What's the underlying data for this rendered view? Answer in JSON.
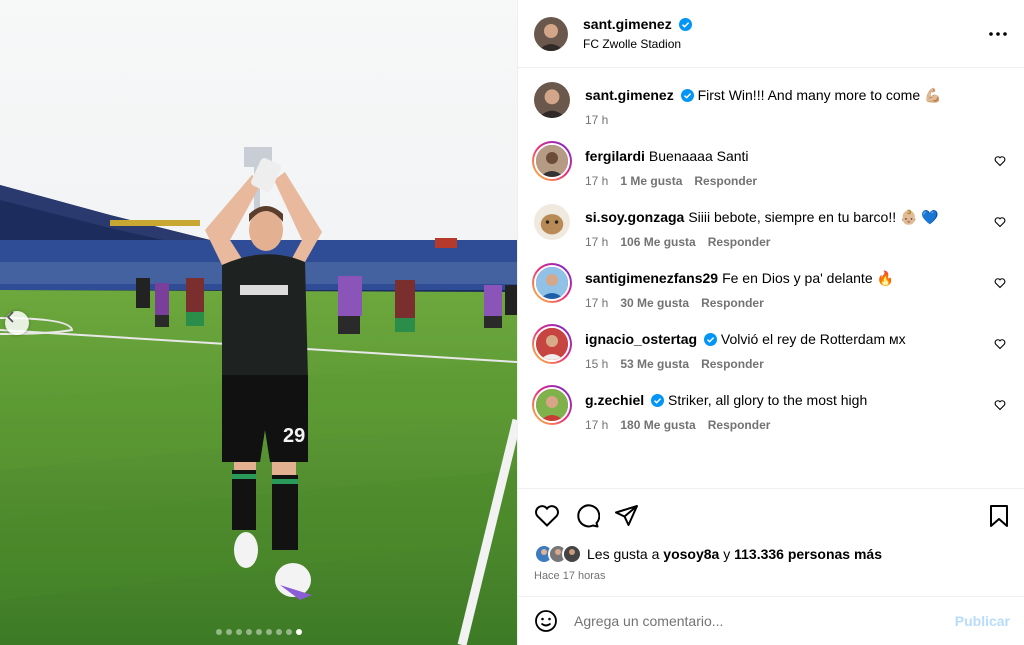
{
  "post": {
    "author": "sant.gimenez",
    "location": "FC Zwolle Stadion",
    "caption": "First Win!!! And many more to come 💪🏼",
    "caption_time": "17 h",
    "photo_count": 9,
    "active_photo": 9
  },
  "comments": [
    {
      "user": "fergilardi",
      "text": "Buenaaaa Santi",
      "time": "17 h",
      "likes": "1 Me gusta",
      "reply": "Responder",
      "verified": false
    },
    {
      "user": "si.soy.gonzaga",
      "text": "Siiii bebote, siempre en tu barco!! 👶🏼 💙",
      "time": "17 h",
      "likes": "106 Me gusta",
      "reply": "Responder",
      "verified": false
    },
    {
      "user": "santigimenezfans29",
      "text": "Fe en Dios y pa' delante 🔥",
      "time": "17 h",
      "likes": "30 Me gusta",
      "reply": "Responder",
      "verified": false
    },
    {
      "user": "ignacio_ostertag",
      "text": "Volvió el rey de Rotterdam ᴍx",
      "time": "15 h",
      "likes": "53 Me gusta",
      "reply": "Responder",
      "verified": true
    },
    {
      "user": "g.zechiel",
      "text": "Striker, all glory to the most high",
      "time": "17 h",
      "likes": "180 Me gusta",
      "reply": "Responder",
      "verified": true
    }
  ],
  "likes": {
    "prefix": "Les gusta a",
    "user": "yosoy8a",
    "joiner": "y",
    "others": "113.336 personas más"
  },
  "posted": "Hace 17 horas",
  "composer": {
    "placeholder": "Agrega un comentario...",
    "publish": "Publicar"
  },
  "colors": {
    "verified": "#0095f6",
    "publish_disabled": "#b7dcfc",
    "muted": "#737373"
  },
  "icons": [
    "chevron-left-icon",
    "more-icon",
    "verified-icon",
    "heart-icon",
    "comment-icon",
    "share-icon",
    "bookmark-icon",
    "emoji-icon"
  ]
}
